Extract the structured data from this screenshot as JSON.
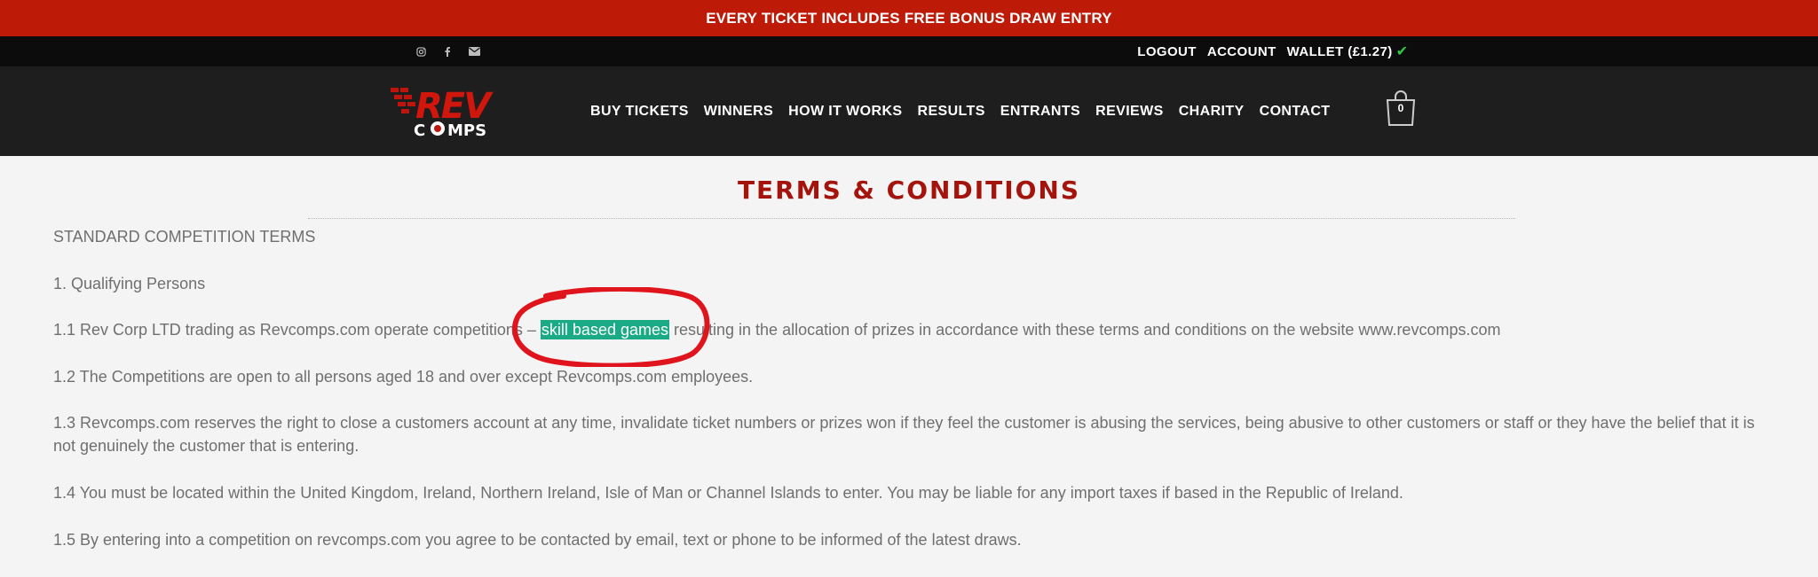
{
  "promo": {
    "text": "EVERY TICKET INCLUDES FREE BONUS DRAW ENTRY"
  },
  "social": {
    "icons": [
      "instagram-icon",
      "facebook-icon",
      "email-icon"
    ]
  },
  "account": {
    "logout": "LOGOUT",
    "account": "ACCOUNT",
    "wallet": "WALLET (£1.27)"
  },
  "logo": {
    "top": "REV",
    "bottom": "COMPS"
  },
  "nav": {
    "items": [
      "BUY TICKETS",
      "WINNERS",
      "HOW IT WORKS",
      "RESULTS",
      "ENTRANTS",
      "REVIEWS",
      "CHARITY",
      "CONTACT"
    ]
  },
  "cart": {
    "count": "0"
  },
  "page": {
    "title": "TERMS & CONDITIONS",
    "heading": "STANDARD COMPETITION TERMS",
    "section1": "1. Qualifying Persons",
    "p1_1_pre": "1.1 Rev Corp LTD trading as Revcomps.com operate competitions – ",
    "p1_1_highlight": "skill based games",
    "p1_1_post": " resulting in the allocation of prizes in accordance with these terms and conditions on the website www.revcomps.com",
    "p1_2": "1.2 The Competitions are open to all persons aged 18 and over except Revcomps.com employees.",
    "p1_3": "1.3 Revcomps.com reserves the right to close a customers account at any time, invalidate ticket numbers or prizes won if they feel the customer is abusing the services, being abusive to other customers or staff or they have the belief that it is not genuinely the customer that is entering.",
    "p1_4": "1.4 You must be located within the United Kingdom, Ireland, Northern Ireland, Isle of Man or Channel Islands to enter. You may be liable for any import taxes if based in the Republic of Ireland.",
    "p1_5": "1.5 By entering into a competition on revcomps.com you agree to be contacted by email, text or phone to be informed of the latest draws."
  },
  "colors": {
    "promo": "#bd1a08",
    "title": "#a4140c",
    "highlight": "#1aab86",
    "annotation": "#e0141c"
  }
}
